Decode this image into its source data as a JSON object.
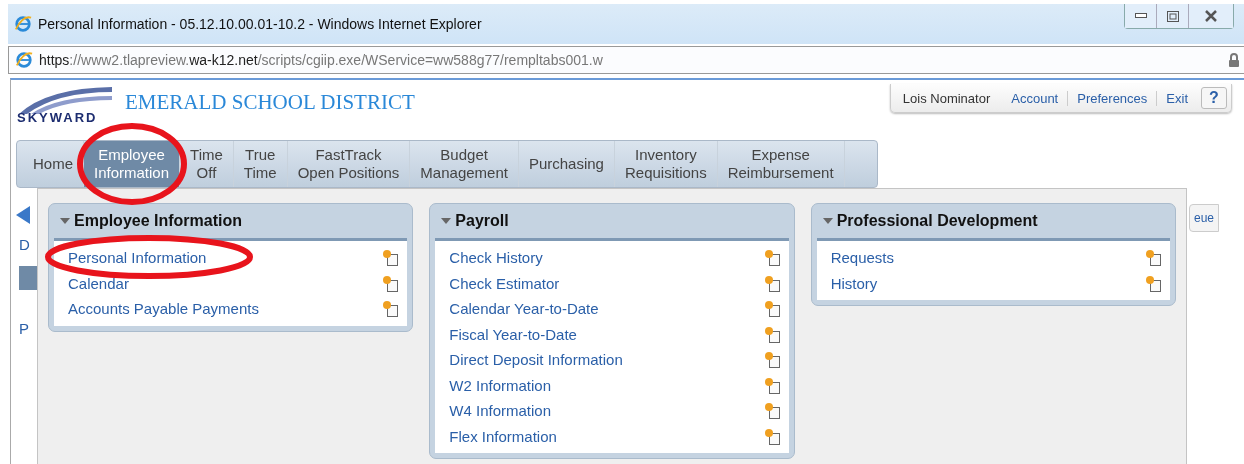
{
  "window": {
    "title": "Personal Information - 05.12.10.00.01-10.2 - Windows Internet Explorer"
  },
  "address": {
    "segments": [
      {
        "text": "https",
        "emphasis": true
      },
      {
        "text": "://www2.tlapreview.",
        "emphasis": false
      },
      {
        "text": "wa-k12.net",
        "emphasis": true
      },
      {
        "text": "/scripts/cgiip.exe/WService=ww588g77/rempltabs001.w",
        "emphasis": false
      }
    ]
  },
  "header": {
    "logo": "SKYWARD",
    "district": "EMERALD SCHOOL DISTRICT",
    "user": "Lois Nominator",
    "links": [
      "Account",
      "Preferences",
      "Exit"
    ],
    "help": "?"
  },
  "tabs": [
    {
      "label": "Home",
      "selected": false
    },
    {
      "label": "Employee\nInformation",
      "selected": true
    },
    {
      "label": "Time\nOff",
      "selected": false
    },
    {
      "label": "True\nTime",
      "selected": false
    },
    {
      "label": "FastTrack\nOpen Positions",
      "selected": false
    },
    {
      "label": "Budget\nManagement",
      "selected": false
    },
    {
      "label": "Purchasing",
      "selected": false
    },
    {
      "label": "Inventory\nRequisitions",
      "selected": false
    },
    {
      "label": "Expense\nReimbursement",
      "selected": false
    }
  ],
  "background": {
    "fragments": [
      "D",
      "P"
    ],
    "button": "eue"
  },
  "panels": [
    {
      "title": "Employee Information",
      "items": [
        "Personal Information",
        "Calendar",
        "Accounts Payable Payments"
      ]
    },
    {
      "title": "Payroll",
      "items": [
        "Check History",
        "Check Estimator",
        "Calendar Year-to-Date",
        "Fiscal Year-to-Date",
        "Direct Deposit Information",
        "W2 Information",
        "W4 Information",
        "Flex Information"
      ]
    },
    {
      "title": "Professional Development",
      "items": [
        "Requests",
        "History"
      ]
    }
  ]
}
